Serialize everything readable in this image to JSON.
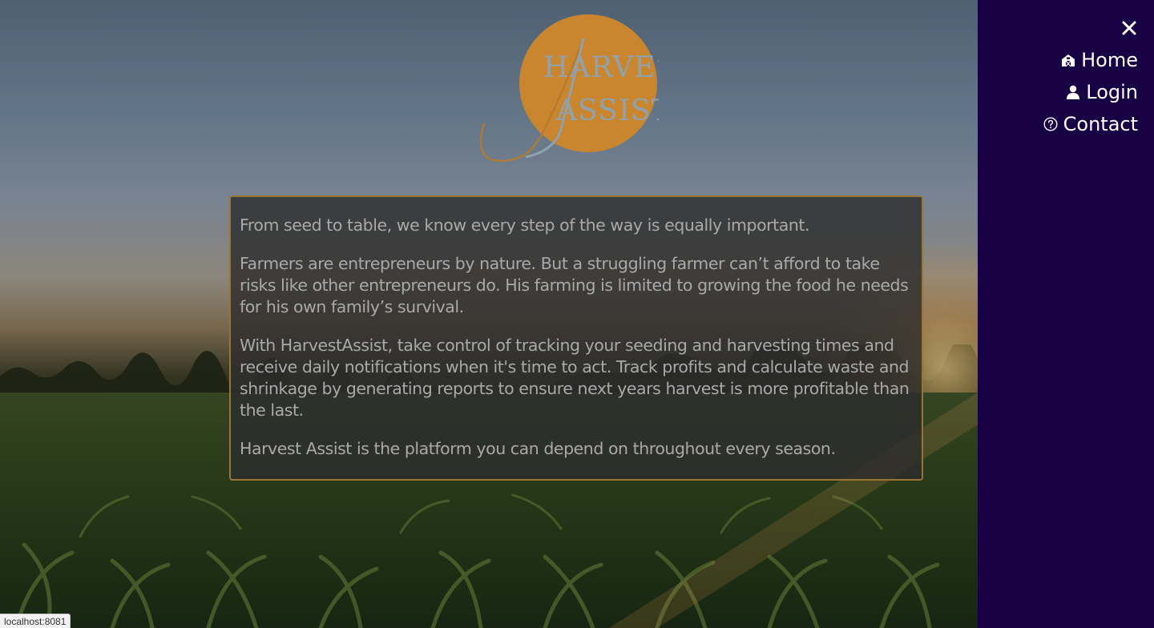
{
  "logo": {
    "line1": "HARVEST",
    "line2": "ASSIST",
    "color": "#c9862f"
  },
  "content": {
    "paragraphs": [
      "From seed to table, we know every step of the way is equally important.",
      "Farmers are entrepreneurs by nature. But a struggling farmer can’t afford to take risks like other entrepreneurs do. His farming is limited to growing the food he needs for his own family’s survival.",
      "With HarvestAssist, take control of tracking your seeding and harvesting times and receive daily notifications when it's time to act. Track profits and calculate waste and shrinkage by generating reports to ensure next years harvest is more profitable than the last.",
      "Harvest Assist is the platform you can depend on throughout every season."
    ]
  },
  "sidenav": {
    "background": "#170043",
    "close_icon": "close-icon",
    "items": [
      {
        "label": "Home",
        "icon": "barn-icon"
      },
      {
        "label": "Login",
        "icon": "user-icon"
      },
      {
        "label": "Contact",
        "icon": "help-circle-icon"
      }
    ]
  },
  "statusbar": {
    "url": "localhost:8081"
  }
}
